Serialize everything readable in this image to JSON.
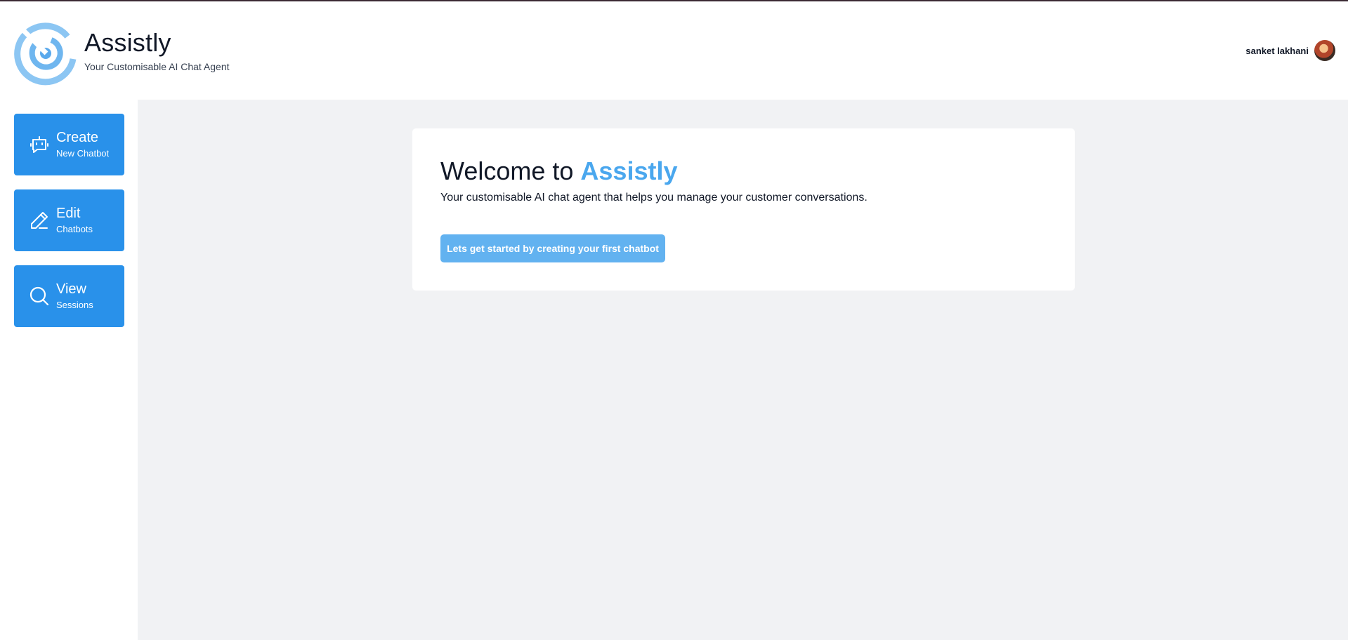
{
  "header": {
    "brand_title": "Assistly",
    "brand_subtitle": "Your Customisable AI Chat Agent",
    "user_name": "sanket lakhani"
  },
  "sidebar": {
    "items": [
      {
        "title": "Create",
        "subtitle": "New Chatbot",
        "icon": "bot-message-icon"
      },
      {
        "title": "Edit",
        "subtitle": "Chatbots",
        "icon": "pencil-icon"
      },
      {
        "title": "View",
        "subtitle": "Sessions",
        "icon": "search-icon"
      }
    ]
  },
  "main": {
    "welcome_prefix": "Welcome to ",
    "welcome_brand": "Assistly",
    "tagline": "Your customisable AI chat agent that helps you manage your customer conversations.",
    "cta_label": "Lets get started by creating your first chatbot"
  },
  "colors": {
    "primary": "#2991ea",
    "brand_accent": "#4aa7ee",
    "cta": "#62b2f0",
    "content_bg": "#f1f2f4"
  }
}
